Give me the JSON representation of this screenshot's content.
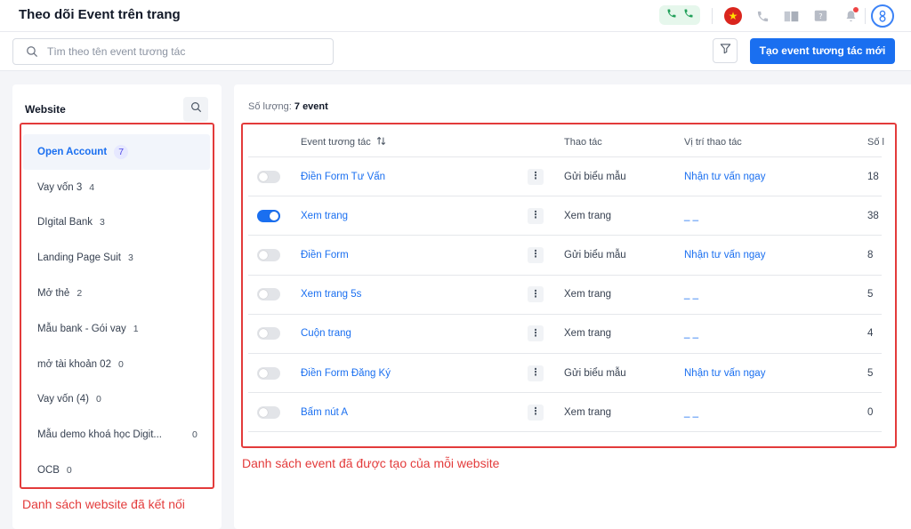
{
  "header": {
    "title": "Theo dõi Event trên trang"
  },
  "toolbar": {
    "search_placeholder": "Tìm theo tên event tương tác",
    "create_button": "Tạo event tương tác mới"
  },
  "sidebar": {
    "title": "Website",
    "items": [
      {
        "name": "Open Account",
        "count": "7"
      },
      {
        "name": "Vay vốn 3",
        "count": "4"
      },
      {
        "name": "DIgital Bank",
        "count": "3"
      },
      {
        "name": "Landing Page Suit",
        "count": "3"
      },
      {
        "name": "Mở thẻ",
        "count": "2"
      },
      {
        "name": "Mẫu bank - Gói vay",
        "count": "1"
      },
      {
        "name": "mở tài khoản 02",
        "count": "0"
      },
      {
        "name": "Vay vốn (4)",
        "count": "0"
      },
      {
        "name": "Mẫu demo khoá học Digit...",
        "count": "0"
      },
      {
        "name": "OCB",
        "count": "0"
      }
    ]
  },
  "main": {
    "count_label": "Số lượng:",
    "count_value": "7 event",
    "columns": {
      "event": "Event tương tác",
      "action": "Thao tác",
      "position": "Vị trí thao tác",
      "number": "Số l"
    },
    "rows": [
      {
        "enabled": false,
        "name": "Điền Form Tư Vấn",
        "action": "Gửi biểu mẫu",
        "position": "Nhận tư vấn ngay",
        "number": "18"
      },
      {
        "enabled": true,
        "name": "Xem trang",
        "action": "Xem trang",
        "position": "_ _",
        "number": "38"
      },
      {
        "enabled": false,
        "name": "Điền Form",
        "action": "Gửi biểu mẫu",
        "position": "Nhận tư vấn ngay",
        "number": "8"
      },
      {
        "enabled": false,
        "name": "Xem trang 5s",
        "action": "Xem trang",
        "position": "_ _",
        "number": "5"
      },
      {
        "enabled": false,
        "name": "Cuộn trang",
        "action": "Xem trang",
        "position": "_ _",
        "number": "4"
      },
      {
        "enabled": false,
        "name": "Điền Form Đăng Ký",
        "action": "Gửi biểu mẫu",
        "position": "Nhận tư vấn ngay",
        "number": "5"
      },
      {
        "enabled": false,
        "name": "Bấm nút A",
        "action": "Xem trang",
        "position": "_ _",
        "number": "0"
      }
    ]
  },
  "annotations": {
    "sidebar_note": "Danh sách website đã kết nối",
    "table_note": "Danh sách event đã được tạo của mỗi website"
  },
  "colors": {
    "accent": "#1a6ff0",
    "annotation": "#e33b3b"
  }
}
